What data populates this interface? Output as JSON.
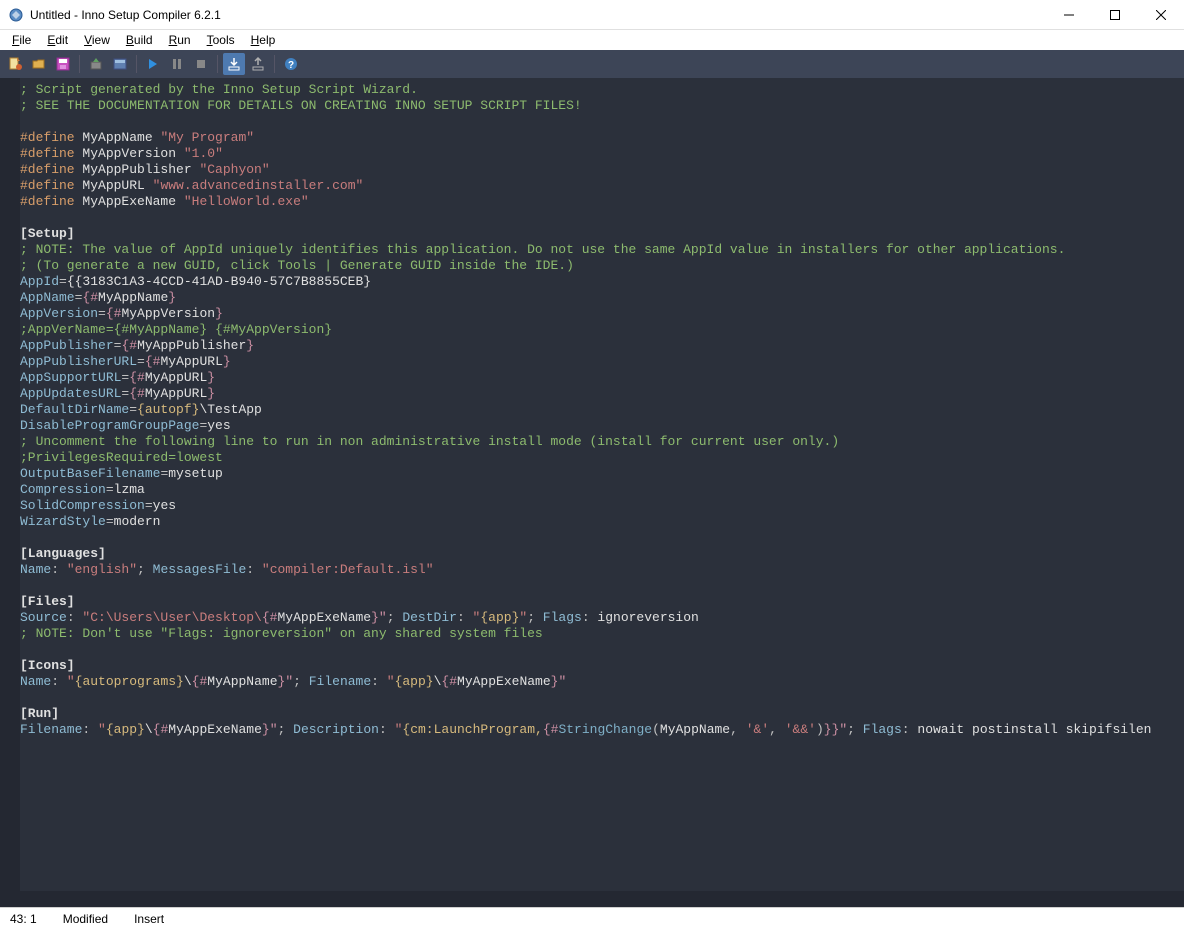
{
  "window": {
    "title": "Untitled - Inno Setup Compiler 6.2.1"
  },
  "menu": {
    "items": [
      "File",
      "Edit",
      "View",
      "Build",
      "Run",
      "Tools",
      "Help"
    ]
  },
  "toolbar": {
    "icons": [
      "new",
      "open",
      "save",
      "sep",
      "compile",
      "compile-run",
      "sep",
      "run",
      "pause",
      "stop",
      "sep",
      "dl1",
      "dl2",
      "sep",
      "help"
    ]
  },
  "statusbar": {
    "pos": "43:   1",
    "modified": "Modified",
    "mode": "Insert"
  },
  "code": {
    "lines": [
      {
        "t": "comment",
        "s": "; Script generated by the Inno Setup Script Wizard."
      },
      {
        "t": "comment",
        "s": "; SEE THE DOCUMENTATION FOR DETAILS ON CREATING INNO SETUP SCRIPT FILES!"
      },
      {
        "t": "blank",
        "s": ""
      },
      {
        "t": "define",
        "dir": "#define",
        "name": "MyAppName",
        "val": "\"My Program\""
      },
      {
        "t": "define",
        "dir": "#define",
        "name": "MyAppVersion",
        "val": "\"1.0\""
      },
      {
        "t": "define",
        "dir": "#define",
        "name": "MyAppPublisher",
        "val": "\"Caphyon\""
      },
      {
        "t": "define",
        "dir": "#define",
        "name": "MyAppURL",
        "val": "\"www.advancedinstaller.com\""
      },
      {
        "t": "define",
        "dir": "#define",
        "name": "MyAppExeName",
        "val": "\"HelloWorld.exe\""
      },
      {
        "t": "blank",
        "s": ""
      },
      {
        "t": "section",
        "s": "[Setup]"
      },
      {
        "t": "comment",
        "s": "; NOTE: The value of AppId uniquely identifies this application. Do not use the same AppId value in installers for other applications."
      },
      {
        "t": "comment",
        "s": "; (To generate a new GUID, click Tools | Generate GUID inside the IDE.)"
      },
      {
        "t": "kv",
        "k": "AppId",
        "v": "{{3183C1A3-4CCD-41AD-B940-57C7B8855CEB}"
      },
      {
        "t": "kvvar",
        "k": "AppName",
        "pre": "{",
        "hash": "#",
        "var": "MyAppName",
        "post": "}"
      },
      {
        "t": "kvvar",
        "k": "AppVersion",
        "pre": "{",
        "hash": "#",
        "var": "MyAppVersion",
        "post": "}"
      },
      {
        "t": "comment",
        "s": ";AppVerName={#MyAppName} {#MyAppVersion}"
      },
      {
        "t": "kvvar",
        "k": "AppPublisher",
        "pre": "{",
        "hash": "#",
        "var": "MyAppPublisher",
        "post": "}"
      },
      {
        "t": "kvvar",
        "k": "AppPublisherURL",
        "pre": "{",
        "hash": "#",
        "var": "MyAppURL",
        "post": "}"
      },
      {
        "t": "kvvar",
        "k": "AppSupportURL",
        "pre": "{",
        "hash": "#",
        "var": "MyAppURL",
        "post": "}"
      },
      {
        "t": "kvvar",
        "k": "AppUpdatesURL",
        "pre": "{",
        "hash": "#",
        "var": "MyAppURL",
        "post": "}"
      },
      {
        "t": "kvmixed",
        "k": "DefaultDirName",
        "parts": [
          {
            "c": "const",
            "s": "{autopf}"
          },
          {
            "c": "ident",
            "s": "\\TestApp"
          }
        ]
      },
      {
        "t": "kv",
        "k": "DisableProgramGroupPage",
        "v": "yes"
      },
      {
        "t": "comment",
        "s": "; Uncomment the following line to run in non administrative install mode (install for current user only.)"
      },
      {
        "t": "comment",
        "s": ";PrivilegesRequired=lowest"
      },
      {
        "t": "kv",
        "k": "OutputBaseFilename",
        "v": "mysetup"
      },
      {
        "t": "kv",
        "k": "Compression",
        "v": "lzma"
      },
      {
        "t": "kv",
        "k": "SolidCompression",
        "v": "yes"
      },
      {
        "t": "kv",
        "k": "WizardStyle",
        "v": "modern"
      },
      {
        "t": "blank",
        "s": ""
      },
      {
        "t": "section",
        "s": "[Languages]"
      },
      {
        "t": "lang",
        "name_k": "Name",
        "name_v": "\"english\"",
        "msg_k": "MessagesFile",
        "msg_v": "\"compiler:Default.isl\""
      },
      {
        "t": "blank",
        "s": ""
      },
      {
        "t": "section",
        "s": "[Files]"
      },
      {
        "t": "files",
        "src_k": "Source",
        "src_pre": "\"C:\\Users\\User\\Desktop\\",
        "src_brace": "{",
        "src_hash": "#",
        "src_var": "MyAppExeName",
        "src_post": "}\"",
        "dest_k": "DestDir",
        "dest_v": "\"",
        "dest_const": "{app}",
        "dest_end": "\"",
        "flags_k": "Flags",
        "flags_v": "ignoreversion"
      },
      {
        "t": "comment",
        "s": "; NOTE: Don't use \"Flags: ignoreversion\" on any shared system files"
      },
      {
        "t": "blank",
        "s": ""
      },
      {
        "t": "section",
        "s": "[Icons]"
      },
      {
        "t": "icons",
        "name_k": "Name",
        "p1": "\"",
        "c1": "{autoprograms}",
        "slash": "\\",
        "b": "{",
        "h": "#",
        "var": "MyAppName",
        "e": "}\"",
        "fn_k": "Filename",
        "fp1": "\"",
        "fc1": "{app}",
        "fslash": "\\",
        "fb": "{",
        "fh": "#",
        "fvar": "MyAppExeName",
        "fe": "}\""
      },
      {
        "t": "blank",
        "s": ""
      },
      {
        "t": "section",
        "s": "[Run]"
      },
      {
        "t": "run",
        "fn_k": "Filename",
        "fp1": "\"",
        "fc1": "{app}",
        "fslash": "\\",
        "fb": "{",
        "fh": "#",
        "fvar": "MyAppExeName",
        "fe": "}\"",
        "desc_k": "Description",
        "dp1": "\"",
        "dc": "{cm:LaunchProgram,",
        "db": "{",
        "dh": "#",
        "dfunc": "StringChange",
        "dpar": "(",
        "darg1": "MyAppName",
        "dcom": ", ",
        "ds1": "'&'",
        "dcom2": ", ",
        "ds2": "'&&'",
        "dcp": ")",
        "de": "}}\"",
        "flags_k": "Flags",
        "flags_v": "nowait postinstall skipifsilen"
      }
    ]
  }
}
